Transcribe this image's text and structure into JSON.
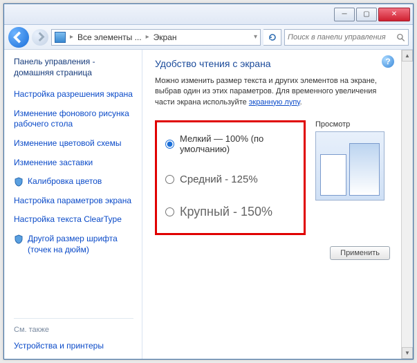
{
  "breadcrumb": {
    "seg1": "Все элементы ...",
    "seg2": "Экран"
  },
  "search": {
    "placeholder": "Поиск в панели управления"
  },
  "sidebar": {
    "home": "Панель управления - домашняя страница",
    "links": [
      "Настройка разрешения экрана",
      "Изменение фонового рисунка рабочего стола",
      "Изменение цветовой схемы",
      "Изменение заставки",
      "Калибровка цветов",
      "Настройка параметров экрана",
      "Настройка текста ClearType",
      "Другой размер шрифта (точек на дюйм)"
    ],
    "also_label": "См. также",
    "also_link": "Устройства и принтеры"
  },
  "main": {
    "heading": "Удобство чтения с экрана",
    "desc_prefix": "Можно изменить размер текста и других элементов на экране, выбрав один из этих параметров. Для временного увеличения части экрана используйте ",
    "desc_link": "экранную лупу",
    "desc_suffix": ".",
    "options": [
      {
        "label": "Мелкий — 100% (по умолчанию)",
        "checked": true,
        "cls": ""
      },
      {
        "label": "Средний - 125%",
        "checked": false,
        "cls": "med"
      },
      {
        "label": "Крупный - 150%",
        "checked": false,
        "cls": "big"
      }
    ],
    "preview_label": "Просмотр",
    "apply_label": "Применить"
  }
}
